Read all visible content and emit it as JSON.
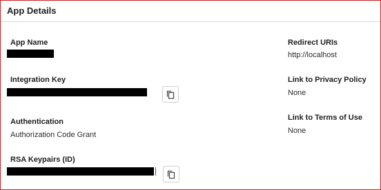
{
  "panel": {
    "title": "App Details"
  },
  "fields": {
    "app_name": {
      "label": "App Name"
    },
    "integration_key": {
      "label": "Integration Key"
    },
    "authentication": {
      "label": "Authentication",
      "value": "Authorization Code Grant"
    },
    "rsa_keypairs": {
      "label": "RSA Keypairs (ID)"
    },
    "redirect_uris": {
      "label": "Redirect URIs",
      "value": "http://localhost"
    },
    "privacy_policy": {
      "label": "Link to Privacy Policy",
      "value": "None"
    },
    "terms_of_use": {
      "label": "Link to Terms of Use",
      "value": "None"
    }
  },
  "icons": {
    "copy": "copy-icon"
  },
  "colors": {
    "border": "#cc1f1f",
    "redaction": "#000000"
  }
}
